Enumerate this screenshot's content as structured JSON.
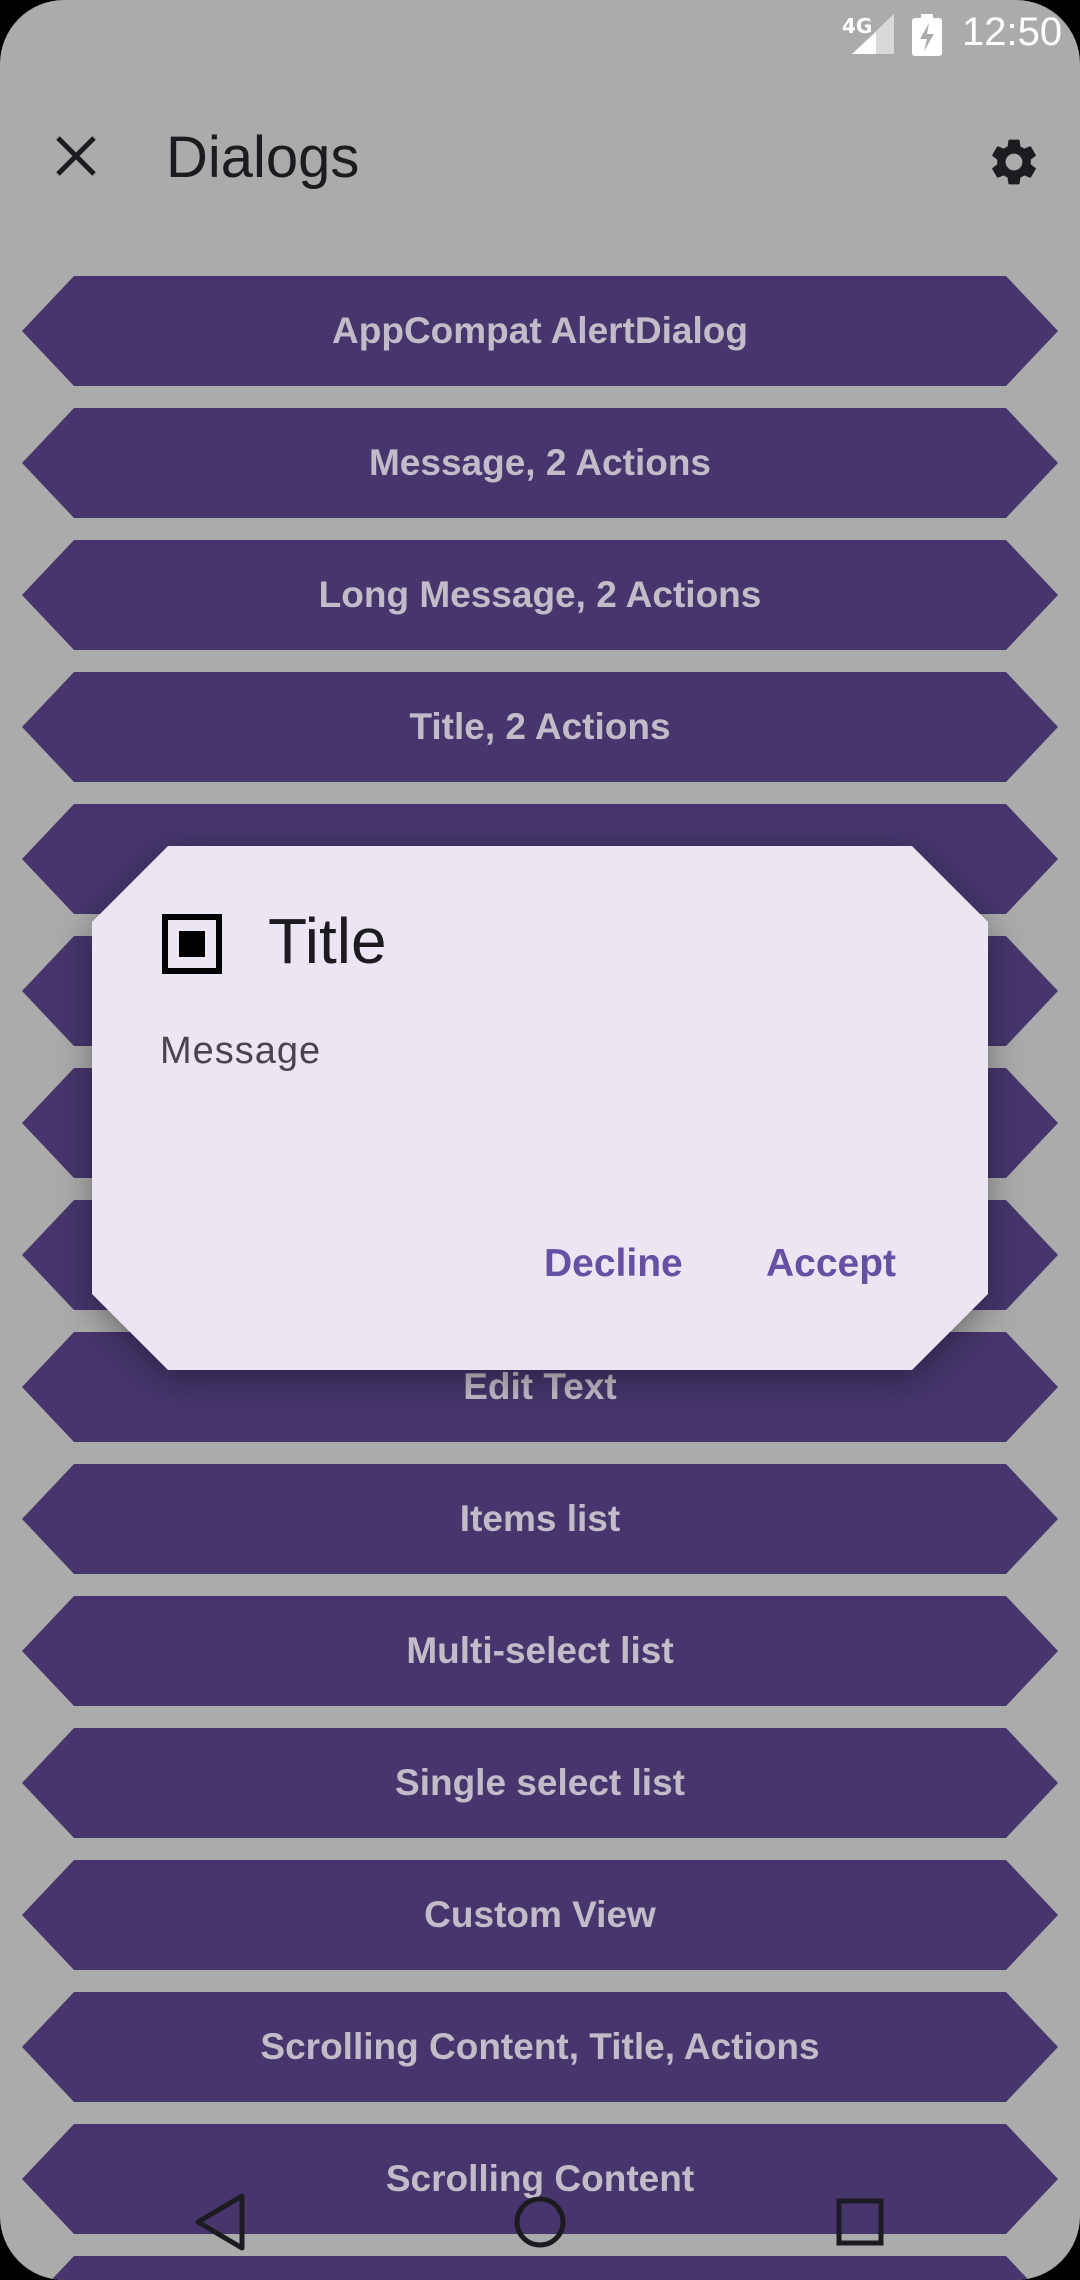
{
  "status_bar": {
    "network_label": "4G",
    "time": "12:50"
  },
  "app_bar": {
    "title": "Dialogs",
    "close_icon": "close-icon",
    "settings_icon": "gear-icon"
  },
  "buttons": [
    "AppCompat AlertDialog",
    "Message, 2 Actions",
    "Long Message, 2 Actions",
    "Title, 2 Actions",
    "",
    "",
    "",
    "",
    "Edit Text",
    "Items list",
    "Multi-select list",
    "Single select list",
    "Custom View",
    "Scrolling Content, Title, Actions",
    "Scrolling Content"
  ],
  "dialog": {
    "icon": "stop-square-icon",
    "title": "Title",
    "message": "Message",
    "decline_label": "Decline",
    "accept_label": "Accept"
  },
  "nav_bar": {
    "back_icon": "back-triangle-icon",
    "home_icon": "home-circle-icon",
    "recents_icon": "recents-square-icon"
  },
  "colors": {
    "background": "#ababab",
    "button": "#46366d",
    "button_text": "#c2bcc8",
    "dialog_surface": "#ece6f3",
    "dialog_action": "#6650a4"
  }
}
